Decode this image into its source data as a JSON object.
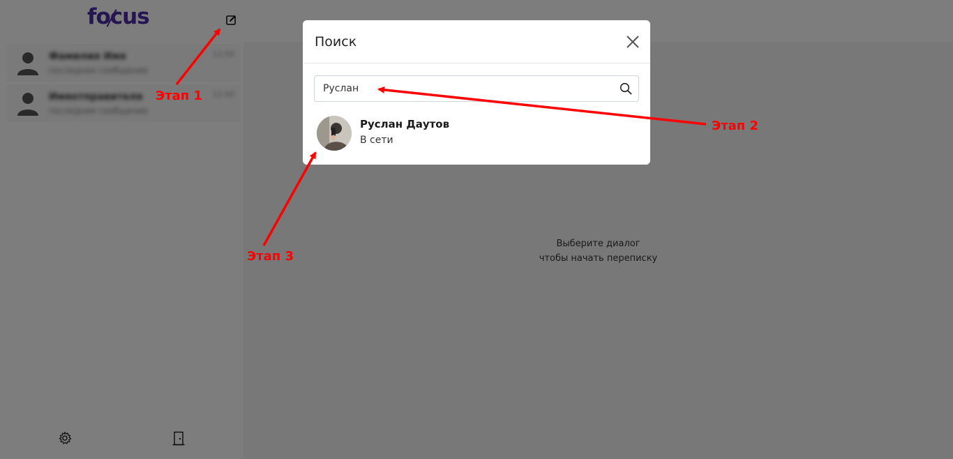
{
  "app": {
    "logo": "focus",
    "empty_state": {
      "line1": "Выберите диалог",
      "line2": "чтобы начать переписку"
    },
    "sidebar": {
      "chats": [
        {
          "name": "Фамилия Имя",
          "preview": "последнее сообщение",
          "time": "12:00"
        },
        {
          "name": "Имяотправителя",
          "preview": "последнее сообщение",
          "time": "12:00"
        }
      ],
      "icons": {
        "compose": "compose-icon",
        "settings": "gear-icon",
        "logout": "door-icon"
      }
    }
  },
  "modal": {
    "title": "Поиск",
    "search": {
      "value": "Руслан",
      "icon": "search-icon"
    },
    "results": [
      {
        "name": "Руслан Даутов",
        "status": "В сети"
      }
    ]
  },
  "annotations": {
    "step1": "Этап 1",
    "step2": "Этап 2",
    "step3": "Этап 3",
    "color": "#ff0000"
  },
  "colors": {
    "brand": "#4a2aa0",
    "overlay": "rgba(0,0,0,0.5)"
  }
}
